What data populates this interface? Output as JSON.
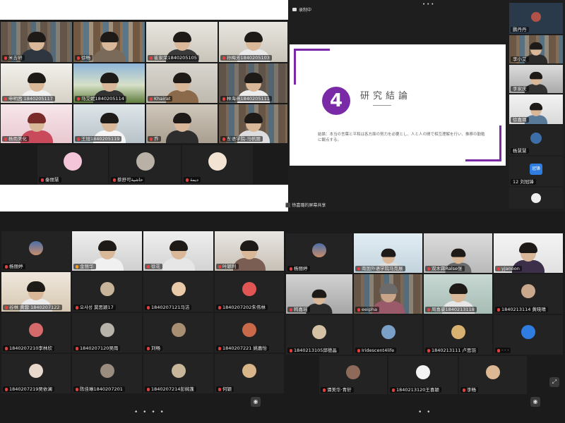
{
  "top_left": {
    "tiles": [
      {
        "name": "米吉研",
        "kind": "video"
      },
      {
        "name": "徐畅",
        "kind": "video"
      },
      {
        "name": "崔家荣1840205105",
        "kind": "video"
      },
      {
        "name": "孙梅芳1840205103",
        "kind": "video"
      },
      {
        "name": "申明茜 1840205117",
        "kind": "video"
      },
      {
        "name": "马艾妮1840205114",
        "kind": "video"
      },
      {
        "name": "Khairat",
        "kind": "video"
      },
      {
        "name": "林海燕1840205111",
        "kind": "video"
      },
      {
        "name": "杨雨美化",
        "kind": "video"
      },
      {
        "name": "王旭1840205119",
        "kind": "video"
      },
      {
        "name": "乔",
        "kind": "video"
      },
      {
        "name": "东语学院-马帆丽",
        "kind": "video"
      },
      {
        "name": "秦丽慧",
        "kind": "avatar"
      },
      {
        "name": "蔡舒可حاشية",
        "kind": "avatar"
      },
      {
        "name": "ديمة",
        "kind": "avatar"
      }
    ]
  },
  "top_right": {
    "recording_label": "录制中",
    "slide": {
      "number": "4",
      "title": "研究結論",
      "body": "結論：本当の言葉と平和は各方面の努力を必要とし、人と人の間で相互理解を行い、推察の勤勉に観点する。"
    },
    "sidebar": [
      {
        "name": "鹏丹丹"
      },
      {
        "name": "李小艾"
      },
      {
        "name": "李家庆"
      },
      {
        "name": "徐嘉璐"
      },
      {
        "name": "杨慧慧"
      },
      {
        "name": "12 刘冠锋",
        "avatar_text": "冠锋"
      }
    ],
    "share_bar_text": "徐嘉璐的屏幕共享"
  },
  "bottom_left": {
    "tiles": [
      {
        "name": "杨丽婷",
        "kind": "avatar"
      },
      {
        "name": "金丽华",
        "kind": "video"
      },
      {
        "name": "徐花",
        "kind": "video"
      },
      {
        "name": "叶颖利",
        "kind": "video"
      },
      {
        "name": "谷林 黄蓉 1840207122",
        "kind": "video"
      },
      {
        "name": "오사성 莫思颖17",
        "kind": "avatar"
      },
      {
        "name": "1840207121马洁",
        "kind": "avatar"
      },
      {
        "name": "1840207202朱伟林",
        "kind": "avatar"
      },
      {
        "name": "1840207210李林欣",
        "kind": "avatar"
      },
      {
        "name": "1840207120吴雨",
        "kind": "avatar"
      },
      {
        "name": "刘畅",
        "kind": "avatar"
      },
      {
        "name": "1840207221 姚嘉怡",
        "kind": "avatar"
      },
      {
        "name": "1840207219吴依澜",
        "kind": "avatar"
      },
      {
        "name": "陈佳琳1840207201",
        "kind": "avatar"
      },
      {
        "name": "1840207214彭婉蓬",
        "kind": "avatar"
      },
      {
        "name": "何颖",
        "kind": "avatar"
      }
    ],
    "page_dots": "• • • •"
  },
  "bottom_right": {
    "tiles": [
      {
        "name": "杨丽婷",
        "kind": "avatar"
      },
      {
        "name": "南国外语学院马克展",
        "kind": "video"
      },
      {
        "name": "双木霖Ralse张",
        "kind": "video"
      },
      {
        "name": "yjanoon",
        "kind": "video"
      },
      {
        "name": "韩嘉瑶",
        "kind": "video"
      },
      {
        "name": "eeipha",
        "kind": "video"
      },
      {
        "name": "周嘉豪1840213118",
        "kind": "video"
      },
      {
        "name": "1840213114 黄晓晴",
        "kind": "avatar"
      },
      {
        "name": "1840213105邱德晶",
        "kind": "avatar"
      },
      {
        "name": "Iridescent4life",
        "kind": "avatar"
      },
      {
        "name": "1840213111 卢思羽",
        "kind": "avatar"
      },
      {
        "name": "· · ·",
        "kind": "avatar-blue"
      },
      {
        "name": "谭美华·青轩",
        "kind": "avatar"
      },
      {
        "name": "1840213120王喜颖",
        "kind": "avatar"
      },
      {
        "name": "李畅",
        "kind": "avatar"
      }
    ],
    "page_dots": "• •"
  },
  "colors": {
    "accent_purple": "#7a2aa6",
    "active_speaker": "#5cd05c",
    "tile_bg": "#232323",
    "avatar_blue": "#2f7de1",
    "avatar_red": "#e25555"
  }
}
